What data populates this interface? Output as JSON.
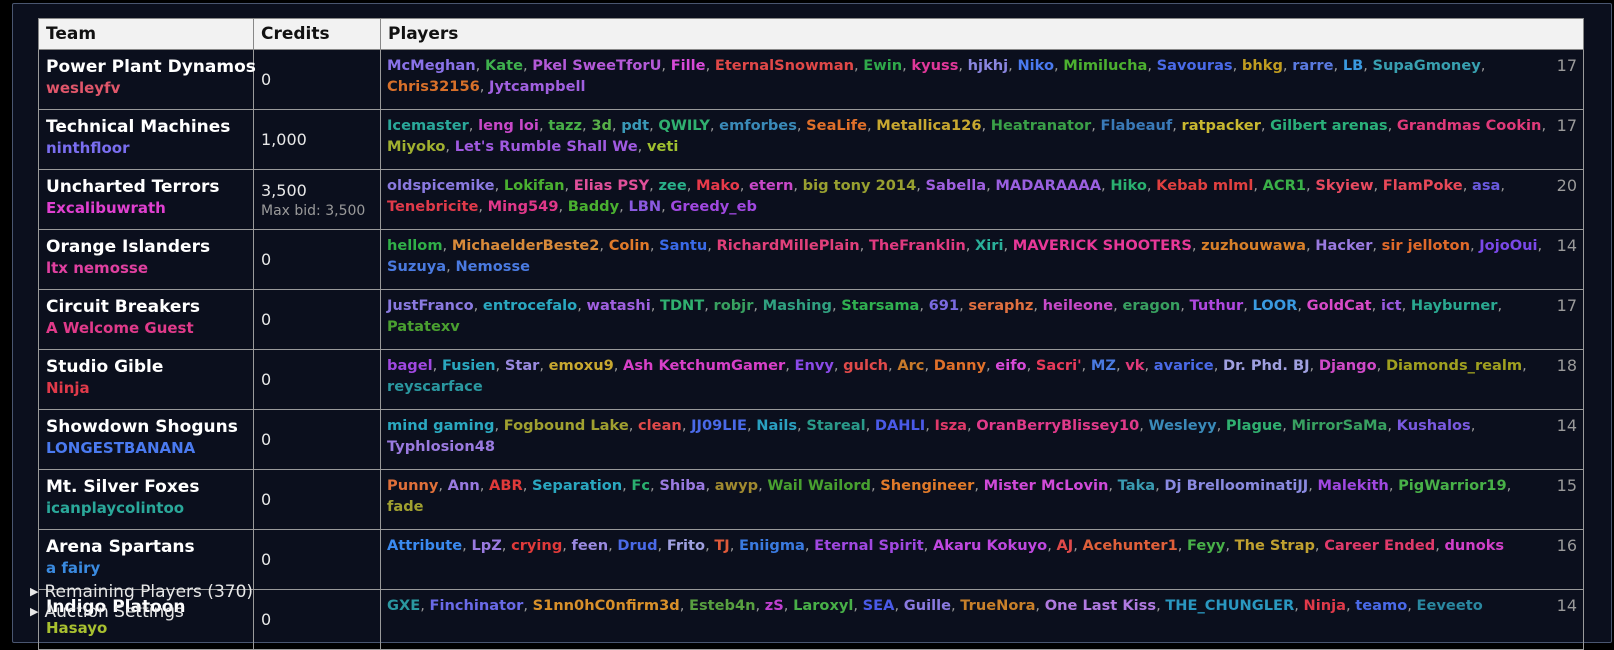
{
  "header": {
    "team": "Team",
    "credits": "Credits",
    "players": "Players"
  },
  "teams": [
    {
      "name": "Power Plant Dynamos",
      "manager": "wesleyfv",
      "manager_color": "#e0566a",
      "credits": "0",
      "max_bid": "",
      "count": "17",
      "players": [
        [
          "McMeghan",
          "#8a72e8"
        ],
        [
          "Kate",
          "#3fb14e"
        ],
        [
          "Pkel SweeTforU",
          "#b45ad8"
        ],
        [
          "Fille",
          "#d84ad8"
        ],
        [
          "EternalSnowman",
          "#e04848"
        ],
        [
          "Ewin",
          "#2fa84a"
        ],
        [
          "kyuss",
          "#e0389a"
        ],
        [
          "hjkhj",
          "#8a86e0"
        ],
        [
          "Niko",
          "#4a7af0"
        ],
        [
          "Mimilucha",
          "#4cb030"
        ],
        [
          "Savouras",
          "#4a6ae8"
        ],
        [
          "bhkg",
          "#c09c20"
        ],
        [
          "rarre",
          "#5a7ae0"
        ],
        [
          "LB",
          "#3a9ae0"
        ],
        [
          "SupaGmoney",
          "#38a0b0"
        ],
        [
          "Chris32156",
          "#d8702a"
        ],
        [
          "Jytcampbell",
          "#a060e0"
        ]
      ]
    },
    {
      "name": "Technical Machines",
      "manager": "ninthfloor",
      "manager_color": "#7a6ef0",
      "credits": "1,000",
      "max_bid": "",
      "count": "17",
      "players": [
        [
          "Icemaster",
          "#2aa89a"
        ],
        [
          "leng loi",
          "#c848c8"
        ],
        [
          "tazz",
          "#48b048"
        ],
        [
          "3d",
          "#58b048"
        ],
        [
          "pdt",
          "#3a9ab8"
        ],
        [
          "QWILY",
          "#30b070"
        ],
        [
          "emforbes",
          "#3a8ab8"
        ],
        [
          "SeaLife",
          "#e0702a"
        ],
        [
          "Metallica126",
          "#c8a830"
        ],
        [
          "Heatranator",
          "#3aa048"
        ],
        [
          "Flabeauf",
          "#3a7ab8"
        ],
        [
          "ratpacker",
          "#c8b830"
        ],
        [
          "Gilbert arenas",
          "#2ab07a"
        ],
        [
          "Grandmas Cookin",
          "#e03a7a"
        ],
        [
          "Miyoko",
          "#a0b030"
        ],
        [
          "Let's Rumble Shall We",
          "#a05ae0"
        ],
        [
          "veti",
          "#a0c030"
        ]
      ]
    },
    {
      "name": "Uncharted Terrors",
      "manager": "Excalibuwrath",
      "manager_color": "#e040d0",
      "credits": "3,500",
      "max_bid": "Max bid: 3,500",
      "count": "20",
      "players": [
        [
          "oldspicemike",
          "#8a7ae0"
        ],
        [
          "Lokifan",
          "#4ab030"
        ],
        [
          "Elias PSY",
          "#e0509a"
        ],
        [
          "zee",
          "#2ab08a"
        ],
        [
          "Mako",
          "#e83a4a"
        ],
        [
          "etern",
          "#c848c8"
        ],
        [
          "big tony 2014",
          "#98a030"
        ],
        [
          "Sabella",
          "#a060e0"
        ],
        [
          "MADARAAAA",
          "#9a60e0"
        ],
        [
          "Hiko",
          "#2ab070"
        ],
        [
          "Kebab mlml",
          "#e04040"
        ],
        [
          "ACR1",
          "#3ab048"
        ],
        [
          "Skyiew",
          "#e84a60"
        ],
        [
          "FlamPoke",
          "#e84858"
        ],
        [
          "asa",
          "#6a5ae0"
        ],
        [
          "Tenebricite",
          "#e03a4a"
        ],
        [
          "Ming549",
          "#e0388a"
        ],
        [
          "Baddy",
          "#4ab030"
        ],
        [
          "LBN",
          "#8a5ae0"
        ],
        [
          "Greedy_eb",
          "#a048e0"
        ]
      ]
    },
    {
      "name": "Orange Islanders",
      "manager": "ltx nemosse",
      "manager_color": "#e040a0",
      "credits": "0",
      "max_bid": "",
      "count": "14",
      "players": [
        [
          "hellom",
          "#30b048"
        ],
        [
          "MichaelderBeste2",
          "#d88a3a"
        ],
        [
          "Colin",
          "#e07a2a"
        ],
        [
          "Santu",
          "#3a6ae8"
        ],
        [
          "RichardMillePlain",
          "#e0407a"
        ],
        [
          "TheFranklin",
          "#e03a80"
        ],
        [
          "Xiri",
          "#2ab09a"
        ],
        [
          "MAVERICK SHOOTERS",
          "#e83898"
        ],
        [
          "zuzhouwawa",
          "#d8802a"
        ],
        [
          "Hacker",
          "#9a7ae0"
        ],
        [
          "sir jelloton",
          "#e06a2a"
        ],
        [
          "JojoOui",
          "#7a48e8"
        ],
        [
          "Suzuya",
          "#4a7ae0"
        ],
        [
          "Nemosse",
          "#4a7ae0"
        ]
      ]
    },
    {
      "name": "Circuit Breakers",
      "manager": "A Welcome Guest",
      "manager_color": "#e03a8a",
      "credits": "0",
      "max_bid": "",
      "count": "17",
      "players": [
        [
          "JustFranco",
          "#8a7ae0"
        ],
        [
          "entrocefalo",
          "#2aa8c0"
        ],
        [
          "watashi",
          "#a060e0"
        ],
        [
          "TDNT",
          "#30b070"
        ],
        [
          "robjr",
          "#38a060"
        ],
        [
          "Mashing",
          "#30a080"
        ],
        [
          "Starsama",
          "#30b050"
        ],
        [
          "691",
          "#7a6ae0"
        ],
        [
          "seraphz",
          "#e07040"
        ],
        [
          "heileone",
          "#c84ac8"
        ],
        [
          "eragon",
          "#38a060"
        ],
        [
          "Tuthur",
          "#b048e0"
        ],
        [
          "LOOR",
          "#3a9ae0"
        ],
        [
          "GoldCat",
          "#d84ac8"
        ],
        [
          "ict",
          "#9a5ae0"
        ],
        [
          "Hayburner",
          "#2aa890"
        ],
        [
          "Patatexv",
          "#4aa030"
        ]
      ]
    },
    {
      "name": "Studio Gible",
      "manager": "Ninja",
      "manager_color": "#e03a4a",
      "credits": "0",
      "max_bid": "",
      "count": "18",
      "players": [
        [
          "bagel",
          "#a048e0"
        ],
        [
          "Fusien",
          "#2aa8c0"
        ],
        [
          "Star",
          "#9a8ae0"
        ],
        [
          "emoxu9",
          "#c8a830"
        ],
        [
          "Ash KetchumGamer",
          "#d840c8"
        ],
        [
          "Envy",
          "#8a4ae8"
        ],
        [
          "gulch",
          "#e04a4a"
        ],
        [
          "Arc",
          "#c87a2a"
        ],
        [
          "Danny",
          "#e0702a"
        ],
        [
          "eifo",
          "#d84ad8"
        ],
        [
          "Sacri'",
          "#e83a5a"
        ],
        [
          "MZ",
          "#4a7ae0"
        ],
        [
          "vk",
          "#e03a7a"
        ],
        [
          "avarice",
          "#4a6ae8"
        ],
        [
          "Dr. Phd. BJ",
          "#a0a0e0"
        ],
        [
          "Django",
          "#d04ac8"
        ],
        [
          "Diamonds_realm",
          "#a0a020"
        ],
        [
          "reyscarface",
          "#2a98a0"
        ]
      ]
    },
    {
      "name": "Showdown Shoguns",
      "manager": "LONGESTBANANA",
      "manager_color": "#4a7af0",
      "credits": "0",
      "max_bid": "",
      "count": "14",
      "players": [
        [
          "mind gaming",
          "#2aa8c0"
        ],
        [
          "Fogbound Lake",
          "#a0a030"
        ],
        [
          "clean",
          "#e04a4a"
        ],
        [
          "JJ09LIE",
          "#4a6ae8"
        ],
        [
          "Nails",
          "#2aa0c0"
        ],
        [
          "Stareal",
          "#2a9a8a"
        ],
        [
          "DAHLI",
          "#4a5ae8"
        ],
        [
          "Isza",
          "#e03a6a"
        ],
        [
          "OranBerryBlissey10",
          "#e03a8a"
        ],
        [
          "Wesleyy",
          "#3a8ab8"
        ],
        [
          "Plague",
          "#30b070"
        ],
        [
          "MirrorSaMa",
          "#38a060"
        ],
        [
          "Kushalos",
          "#7a5ae0"
        ],
        [
          "Typhlosion48",
          "#9a7ae0"
        ]
      ]
    },
    {
      "name": "Mt. Silver Foxes",
      "manager": "icanplaycolintoo",
      "manager_color": "#2aa89a",
      "credits": "0",
      "max_bid": "",
      "count": "15",
      "players": [
        [
          "Punny",
          "#e0703a"
        ],
        [
          "Ann",
          "#9a7ae0"
        ],
        [
          "ABR",
          "#e03a3a"
        ],
        [
          "Separation",
          "#2aa8c0"
        ],
        [
          "Fc",
          "#2ab070"
        ],
        [
          "Shiba",
          "#9a7ae0"
        ],
        [
          "awyp",
          "#a08a30"
        ],
        [
          "Wail Wailord",
          "#48a030"
        ],
        [
          "Shengineer",
          "#e07a2a"
        ],
        [
          "Mister McLovin",
          "#d04ad8"
        ],
        [
          "Taka",
          "#3a9ab0"
        ],
        [
          "Dj BrelloominatiJJ",
          "#8a8ae0"
        ],
        [
          "Malekith",
          "#a048e0"
        ],
        [
          "PigWarrior19",
          "#48b048"
        ],
        [
          "fade",
          "#a0a030"
        ]
      ]
    },
    {
      "name": "Arena Spartans",
      "manager": "a fairy",
      "manager_color": "#3a8ae0",
      "credits": "0",
      "max_bid": "",
      "count": "16",
      "players": [
        [
          "Attribute",
          "#3a8af0"
        ],
        [
          "LpZ",
          "#9a7ae0"
        ],
        [
          "crying",
          "#e03a3a"
        ],
        [
          "feen",
          "#9a8ae0"
        ],
        [
          "Drud",
          "#4a6ae8"
        ],
        [
          "Frito",
          "#a0a0e0"
        ],
        [
          "TJ",
          "#e05a3a"
        ],
        [
          "Eniigma",
          "#3a7ae0"
        ],
        [
          "Eternal Spirit",
          "#a048e0"
        ],
        [
          "Akaru Kokuyo",
          "#c048e0"
        ],
        [
          "AJ",
          "#e04a4a"
        ],
        [
          "Acehunter1",
          "#e0603a"
        ],
        [
          "Feyy",
          "#48b048"
        ],
        [
          "The Strap",
          "#c0a030"
        ],
        [
          "Career Ended",
          "#e03a6a"
        ],
        [
          "dunoks",
          "#d040c8"
        ]
      ]
    },
    {
      "name": "Indigo Platoon",
      "manager": "Hasayo",
      "manager_color": "#a8c030",
      "credits": "0",
      "max_bid": "",
      "count": "14",
      "players": [
        [
          "GXE",
          "#2a98a0"
        ],
        [
          "Finchinator",
          "#6a6ae8"
        ],
        [
          "S1nn0hC0nfirm3d",
          "#d8902a"
        ],
        [
          "Esteb4n",
          "#58a040"
        ],
        [
          "zS",
          "#c040d0"
        ],
        [
          "Laroxyl",
          "#48b048"
        ],
        [
          "SEA",
          "#4a5ae8"
        ],
        [
          "Guille",
          "#8a7ae0"
        ],
        [
          "TrueNora",
          "#c8802a"
        ],
        [
          "One Last Kiss",
          "#b07ae0"
        ],
        [
          "THE_CHUNGLER",
          "#2a98c0"
        ],
        [
          "Ninja",
          "#e03a4a"
        ],
        [
          "teamo",
          "#4a6ae8"
        ],
        [
          "Eeveeto",
          "#2a88a0"
        ]
      ]
    }
  ],
  "footer": {
    "remaining": "Remaining Players (370)",
    "settings": "Auction Settings"
  }
}
